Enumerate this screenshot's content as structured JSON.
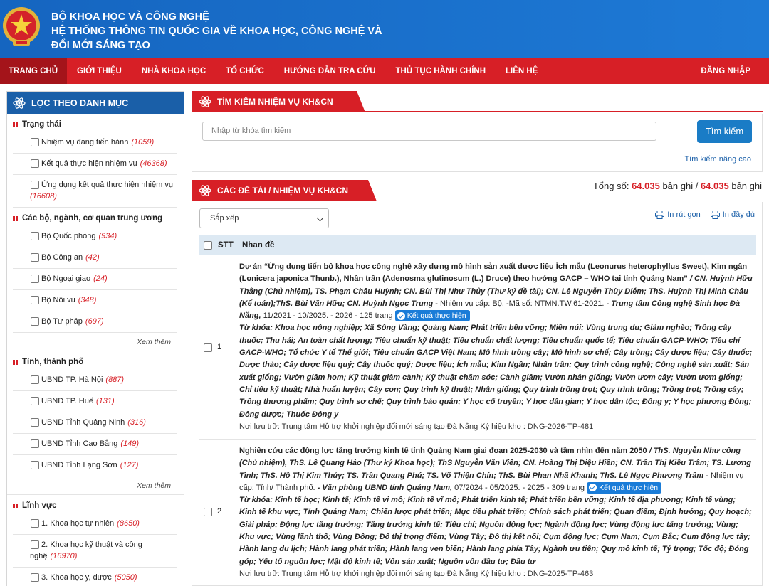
{
  "header": {
    "line1": "BỘ KHOA HỌC VÀ CÔNG NGHỆ",
    "line2": "HỆ THỐNG THÔNG TIN QUỐC GIA VỀ KHOA HỌC, CÔNG NGHỆ VÀ",
    "line3": "ĐỔI MỚI SÁNG TẠO"
  },
  "nav": {
    "items": [
      "TRANG CHỦ",
      "GIỚI THIỆU",
      "NHÀ KHOA HỌC",
      "TỔ CHỨC",
      "HƯỚNG DẪN TRA CỨU",
      "THỦ TỤC HÀNH CHÍNH",
      "LIÊN HỆ"
    ],
    "login": "ĐĂNG NHẬP"
  },
  "sidebar": {
    "title": "LỌC THEO DANH MỤC",
    "more_label": "Xem thêm",
    "sections": [
      {
        "title": "Trạng thái",
        "items": [
          {
            "label": "Nhiệm vụ đang tiến hành",
            "count": "(1059)"
          },
          {
            "label": "Kết quả thực hiện nhiệm vụ",
            "count": "(46368)"
          },
          {
            "label": "Ứng dụng kết quả thực hiện nhiệm vụ",
            "count": "(16608)"
          }
        ]
      },
      {
        "title": "Các bộ, ngành, cơ quan trung ương",
        "items": [
          {
            "label": "Bộ Quốc phòng",
            "count": "(934)"
          },
          {
            "label": "Bộ Công an",
            "count": "(42)"
          },
          {
            "label": "Bộ Ngoại giao",
            "count": "(24)"
          },
          {
            "label": "Bộ Nội vụ",
            "count": "(348)"
          },
          {
            "label": "Bộ Tư pháp",
            "count": "(697)"
          }
        ]
      },
      {
        "title": "Tỉnh, thành phố",
        "items": [
          {
            "label": "UBND TP. Hà Nội",
            "count": "(887)"
          },
          {
            "label": "UBND TP. Huế",
            "count": "(131)"
          },
          {
            "label": "UBND Tỉnh Quảng Ninh",
            "count": "(316)"
          },
          {
            "label": "UBND Tỉnh Cao Bằng",
            "count": "(149)"
          },
          {
            "label": "UBND Tỉnh Lạng Sơn",
            "count": "(127)"
          }
        ]
      },
      {
        "title": "Lĩnh vực",
        "items": [
          {
            "label": "1. Khoa học tự nhiên",
            "count": "(8650)"
          },
          {
            "label": "2. Khoa học kỹ thuật và công nghệ",
            "count": "(16970)"
          },
          {
            "label": "3. Khoa học y, dược",
            "count": "(5050)"
          }
        ]
      }
    ]
  },
  "search": {
    "title": "TÌM KIẾM NHIỆM VỤ KH&CN",
    "placeholder": "Nhập từ khóa tìm kiếm",
    "button": "Tìm kiếm",
    "advanced": "Tìm kiếm nâng cao"
  },
  "results": {
    "title": "CÁC ĐỀ TÀI / NHIỆM VỤ KH&CN",
    "total_prefix": "Tổng số:",
    "total_count": "64.035",
    "total_mid": "bản ghi /",
    "total_all": "64.035",
    "total_suffix": "bản ghi",
    "sort_label": "Sắp xếp",
    "print_short": "In rút gọn",
    "print_full": "In đầy đủ",
    "col_stt": "STT",
    "col_title": "Nhan đề",
    "status_badge": "Kết quả thực hiện",
    "rows": [
      {
        "stt": "1",
        "title": "Dự án “Ứng dụng tiến bộ khoa học công nghệ xây dựng mô hình sản xuất dược liệu Ích mẫu (Leonurus heterophyllus Sweet), Kim ngân (Lonicera japonica Thunb.), Nhân trần (Adenosma glutinosum (L.) Druce) theo hướng GACP – WHO tại tỉnh Quảng Nam”",
        "authors": " / CN. Huỳnh Hữu Thắng (Chủ nhiệm), TS. Phạm Châu Huỳnh; CN. Bùi Thị Như Thủy (Thư ký đề tài); CN. Lê Nguyễn Thùy Diễm; ThS. Huỳnh Thị Minh Châu (Kế toán);ThS. Bùi Văn Hữu; CN. Huỳnh Ngọc Trung",
        "level": " - Nhiệm vụ cấp: Bộ. -Mã số: NTMN.TW.61-2021.",
        "org": " - Trung tâm Công nghệ Sinh học Đà Nẵng,",
        "period": " 11/2021 - 10/2025. - 2026 - 125 trang ",
        "kw_label": "Từ khóa: ",
        "keywords": "Từ khóa: Khoa học nông nghiệp; Xã Sông Vàng; Quảng Nam; Phát triển bền vững; Miền núi; Vùng trung du; Giảm nghèo; Trồng cây thuốc; Thu hái; An toàn chất lượng; Tiêu chuẩn kỹ thuật; Tiêu chuẩn chất lượng; Tiêu chuẩn quốc tế; Tiêu chuẩn GACP-WHO; Tiêu chí GACP-WHO; Tổ chức Y tế Thế giới; Tiêu chuẩn GACP Việt Nam; Mô hình trồng cây; Mô hình sơ chế; Cây trồng; Cây dược liệu; Cây thuốc; Dược thảo; Cây dược liệu quý; Cây thuốc quý; Dược liệu; Ích mẫu; Kim Ngân; Nhân trần; Quy trình công nghệ; Công nghệ sản xuất; Sản xuất giống; Vườn giâm hom; Kỹ thuật giâm cành; Kỹ thuật chăm sóc; Cành giâm; Vườn nhân giống; Vườn ươm cây; Vườn ươm giống; Chỉ tiêu kỹ thuật; Nhà huấn luyện; Cây con; Quy trình kỹ thuật; Nhân giống; Quy trình trồng trọt; Quy trình trồng; Trồng trọt; Trồng cây; Trồng thương phẩm; Quy trình sơ chế; Quy trình bảo quản; Y học cổ truyền; Y học dân gian; Y học dân tộc; Đông y; Y học phương Đông; Đông dược; Thuốc Đông y",
        "location": "Nơi lưu trữ: Trung tâm Hỗ trợ khởi nghiệp đổi mới sáng tạo Đà Nẵng Ký hiệu kho : DNG-2026-TP-481"
      },
      {
        "stt": "2",
        "title": "Nghiên cứu các động lực tăng trưởng kinh tế tỉnh Quảng Nam giai đoạn 2025-2030 và tầm nhìn đến năm 2050",
        "authors": " / ThS. Nguyễn Như công (Chủ nhiệm), ThS. Lê Quang Hảo (Thư ký Khoa học); ThS Nguyễn Văn Viên; CN. Hoàng Thị Diệu Hiền; CN. Trần Thị Kiều Trâm; TS. Lương Tình; ThS. Hồ Thị Kim Thủy; TS. Trần Quang Phú; TS. Võ Thiện Chín; ThS. Bùi Phan Nhã Khanh; ThS. Lê Ngọc Phương Trầm",
        "level": " - Nhiệm vụ cấp: Tỉnh/ Thành phố.",
        "org": " - Văn phòng UBND tỉnh Quảng Nam,",
        "period": " 07/2024 - 05/2025. - 2025 - 309 trang ",
        "keywords": "Từ khóa: Kinh tế học; Kinh tế; Kinh tế vi mô; Kinh tế vĩ mô; Phát triển kinh tế; Phát triển bền vững; Kinh tế địa phương; Kinh tế vùng; Kinh tế khu vực; Tỉnh Quảng Nam; Chiến lược phát triển; Mục tiêu phát triển; Chính sách phát triển; Quan điểm; Định hướng; Quy hoạch; Giải pháp; Động lực tăng trưởng; Tăng trưởng kinh tế; Tiêu chí; Nguồn động lực; Ngành động lực; Vùng động lực tăng trưởng; Vùng; Khu vực; Vùng lãnh thổ; Vùng Đông; Đô thị trọng điểm; Vùng Tây; Đô thị kết nối; Cụm động lực; Cụm Nam; Cụm Bắc; Cụm động lực tây; Hành lang du lịch; Hành lang phát triển; Hành lang ven biển; Hành lang phía Tây; Ngành ưu tiên; Quy mô kinh tế; Tỷ trọng; Tốc độ; Đóng góp; Yếu tố nguồn lực; Mật độ kinh tế; Vốn sản xuất; Nguồn vốn đầu tư; Đầu tư",
        "location": "Nơi lưu trữ: Trung tâm Hỗ trợ khởi nghiệp đổi mới sáng tạo Đà Nẵng Ký hiệu kho : DNG-2025-TP-463"
      }
    ]
  },
  "colors": {
    "header_blue": "#1a73d9",
    "nav_red": "#d71f26",
    "sidebar_blue": "#1a5fa8",
    "badge_blue": "#1a7cd8"
  }
}
